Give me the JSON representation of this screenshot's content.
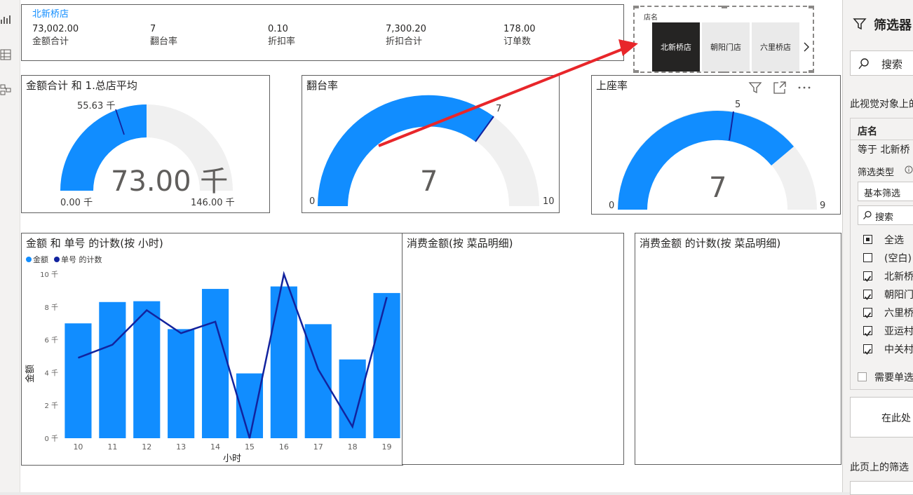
{
  "left_bar": {
    "icons": [
      "report-view-icon",
      "data-view-icon",
      "model-view-icon"
    ]
  },
  "card": {
    "store": "北新桥店",
    "kpis": [
      {
        "value": "73,002.00",
        "label": "金额合计"
      },
      {
        "value": "7",
        "label": "翻台率"
      },
      {
        "value": "0.10",
        "label": "折扣率"
      },
      {
        "value": "7,300.20",
        "label": "折扣合计"
      },
      {
        "value": "178.00",
        "label": "订单数"
      }
    ]
  },
  "slicer": {
    "title": "店名",
    "tiles": [
      {
        "label": "北新桥店",
        "selected": true
      },
      {
        "label": "朝阳门店",
        "selected": false
      },
      {
        "label": "六里桥店",
        "selected": false
      }
    ]
  },
  "gauge1": {
    "title": "金额合计 和 1.总店平均",
    "value_label": "73.00 千",
    "target_label": "55.63 千",
    "min_label": "0.00 千",
    "max_label": "146.00 千",
    "value": 73.0,
    "target": 55.63,
    "min": 0,
    "max": 146
  },
  "gauge2": {
    "title": "翻台率",
    "value_label": "7",
    "target_label": "7",
    "min_label": "0",
    "max_label": "10",
    "value": 7,
    "target": 7,
    "min": 0,
    "max": 10
  },
  "gauge3": {
    "title": "上座率",
    "value_label": "7",
    "target_label": "5",
    "min_label": "0",
    "max_label": "9",
    "value": 7,
    "target": 5,
    "min": 0,
    "max": 9
  },
  "combo_chart": {
    "title": "金额 和 单号 的计数(按 小时)",
    "legend": [
      "金额",
      "单号 的计数"
    ]
  },
  "chart_data": {
    "type": "bar",
    "title": "金额 和 单号 的计数(按 小时)",
    "xlabel": "小时",
    "ylabel": "金额",
    "categories": [
      "10",
      "11",
      "12",
      "13",
      "14",
      "15",
      "16",
      "17",
      "18",
      "19"
    ],
    "yticks": [
      "0 千",
      "2 千",
      "4 千",
      "6 千",
      "8 千",
      "10 千"
    ],
    "ylim": [
      0,
      10000
    ],
    "series": [
      {
        "name": "金额",
        "type": "bar",
        "color": "#118dff",
        "values": [
          7000,
          8300,
          8350,
          6650,
          9100,
          3950,
          9250,
          6950,
          4800,
          8850
        ]
      },
      {
        "name": "单号 的计数",
        "type": "line",
        "color": "#12239e",
        "values": [
          4.9,
          5.7,
          7.8,
          6.4,
          7.1,
          0,
          10,
          4.2,
          0.7,
          8.6
        ]
      }
    ],
    "legend_position": "top-left",
    "grid": false
  },
  "empty_visual_1": {
    "title": "消费金额(按 菜品明细)"
  },
  "empty_visual_2": {
    "title": "消费金额 的计数(按 菜品明细)"
  },
  "filter_pane": {
    "title": "筛选器",
    "search_placeholder": "搜索",
    "section_visual": "此视觉对象上的",
    "field_name": "店名",
    "condition": "等于 北新桥",
    "filter_type_label": "筛选类型",
    "filter_type_value": "基本筛选",
    "inner_search": "搜索",
    "items": [
      {
        "label": "全选",
        "state": "partial"
      },
      {
        "label": "(空白)",
        "state": "unchecked"
      },
      {
        "label": "北新桥",
        "state": "checked"
      },
      {
        "label": "朝阳门",
        "state": "checked"
      },
      {
        "label": "六里桥",
        "state": "checked"
      },
      {
        "label": "亚运村",
        "state": "checked"
      },
      {
        "label": "中关村",
        "state": "checked"
      }
    ],
    "require_single": "需要单选",
    "add_here": "在此处",
    "section_page": "此页上的筛选"
  },
  "gauge3_header_icons": [
    "filter-icon",
    "focus-mode-icon",
    "more-options-icon"
  ]
}
